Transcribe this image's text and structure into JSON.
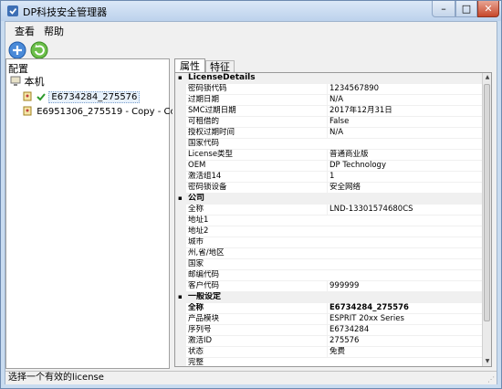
{
  "window": {
    "title": "DP科技安全管理器",
    "min": "–",
    "max": "□",
    "close": "✕"
  },
  "menu": {
    "view": "查看",
    "help": "帮助"
  },
  "toolbar": {
    "icons": [
      "add-license-icon",
      "refresh-icon"
    ]
  },
  "left_pane": {
    "header": "配置",
    "root_label": "本机",
    "nodes": [
      {
        "label": "E6734284_275576",
        "selected": true
      },
      {
        "label": "E6951306_275519 - Copy - Copy - C",
        "selected": false
      }
    ]
  },
  "tabs": {
    "properties": "属性",
    "features": "特征"
  },
  "grid": {
    "sections": [
      {
        "title": "LicenseDetails",
        "rows": [
          {
            "k": "密码锁代码",
            "v": "1234567890"
          },
          {
            "k": "过期日期",
            "v": "N/A"
          },
          {
            "k": "SMC过期日期",
            "v": "2017年12月31日"
          },
          {
            "k": "可租借的",
            "v": "False"
          },
          {
            "k": "授权过期时间",
            "v": "N/A"
          },
          {
            "k": "国家代码",
            "v": ""
          },
          {
            "k": "License类型",
            "v": "普通商业版"
          },
          {
            "k": "OEM",
            "v": "DP Technology"
          },
          {
            "k": "激活组14",
            "v": "1"
          },
          {
            "k": "密码锁设备",
            "v": "安全网络"
          }
        ]
      },
      {
        "title": "公司",
        "rows": [
          {
            "k": "全称",
            "v": "LND-13301574680CS"
          },
          {
            "k": "地址1",
            "v": ""
          },
          {
            "k": "地址2",
            "v": ""
          },
          {
            "k": "城市",
            "v": ""
          },
          {
            "k": "州,省/地区",
            "v": ""
          },
          {
            "k": "国家",
            "v": ""
          },
          {
            "k": "邮编代码",
            "v": ""
          },
          {
            "k": "客户代码",
            "v": "999999"
          }
        ]
      },
      {
        "title": "一般设定",
        "rows": [
          {
            "k": "全称",
            "v": "E6734284_275576",
            "bold": true
          },
          {
            "k": "产品模块",
            "v": "ESPRIT 20xx Series"
          },
          {
            "k": "序列号",
            "v": "E6734284"
          },
          {
            "k": "激活ID",
            "v": "275576"
          },
          {
            "k": "状态",
            "v": "免费"
          },
          {
            "k": "完整",
            "v": ""
          }
        ]
      }
    ]
  },
  "status": "选择一个有效的license",
  "colors": {
    "accent": "#3b7bd4",
    "title_bg": "#c9dcf0",
    "close": "#c7472b"
  }
}
